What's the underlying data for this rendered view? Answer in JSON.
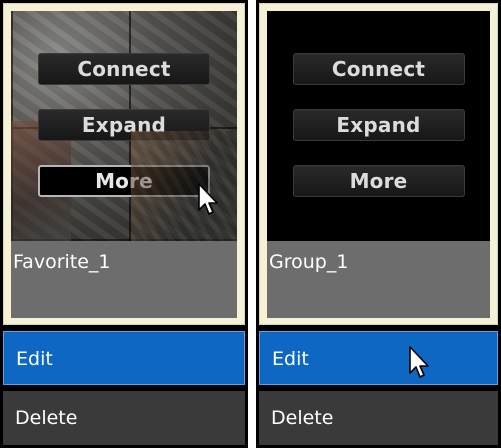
{
  "tiles": [
    {
      "label": "Favorite_1",
      "buttons": {
        "connect": "Connect",
        "expand": "Expand",
        "more": "More"
      },
      "menu": {
        "edit": "Edit",
        "delete": "Delete"
      }
    },
    {
      "label": "Group_1",
      "buttons": {
        "connect": "Connect",
        "expand": "Expand",
        "more": "More"
      },
      "menu": {
        "edit": "Edit",
        "delete": "Delete"
      }
    }
  ],
  "colors": {
    "menu_selected": "#0d67c3",
    "menu_normal": "#3a3a3a",
    "card_border": "#f4f1d6"
  },
  "icons": [
    "mouse-pointer-icon"
  ]
}
